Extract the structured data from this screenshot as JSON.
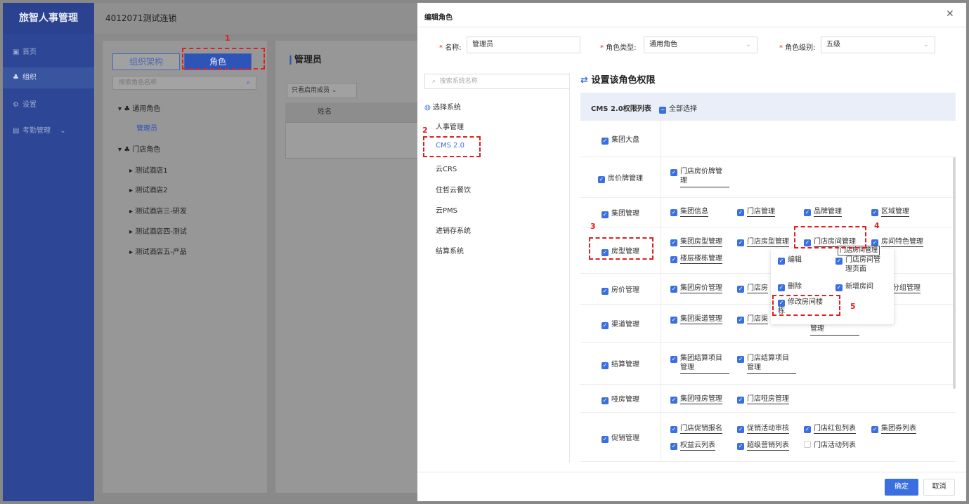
{
  "app": {
    "brand": "旅智人事管理",
    "org_name": "4012071测试连锁",
    "nav": [
      {
        "label": "首页",
        "icon": "home-icon"
      },
      {
        "label": "组织",
        "icon": "org-icon"
      },
      {
        "label": "设置",
        "icon": "gear-icon"
      },
      {
        "label": "考勤管理",
        "icon": "attendance-icon"
      }
    ]
  },
  "left_panel": {
    "tab_org": "组织架构",
    "tab_role": "角色",
    "search_placeholder": "搜索角色名称",
    "tree": {
      "general_role": "通用角色",
      "admin": "管理员",
      "store_role": "门店角色",
      "stores": [
        "测试酒店1",
        "测试酒店2",
        "测试酒店三-研发",
        "测试酒店四-测试",
        "测试酒店五-产品"
      ]
    }
  },
  "middle_panel": {
    "title": "管理员",
    "filter": "只看启用成员",
    "col_name": "姓名"
  },
  "modal": {
    "title": "编辑角色",
    "close": "✕",
    "name_label": "名称:",
    "name_value": "管理员",
    "type_label": "角色类型:",
    "type_value": "通用角色",
    "level_label": "角色级别:",
    "level_value": "五级",
    "sys_search_placeholder": "搜索系统名称",
    "sys_header": "选择系统",
    "systems": [
      "人事管理",
      "CMS 2.0",
      "云CRS",
      "住哲云餐饮",
      "云PMS",
      "进销存系统",
      "结算系统"
    ],
    "selected_system": "CMS 2.0",
    "perm_title": "设置该角色权限",
    "perm_list_label": "CMS 2.0权限列表",
    "select_all": "全部选择",
    "ok": "确定",
    "cancel": "取消"
  },
  "permissions": {
    "r1": {
      "cat": "集团大盘"
    },
    "r2": {
      "cat": "房价牌管理",
      "items": [
        "门店房价牌管",
        "理"
      ]
    },
    "r3": {
      "cat": "集团管理",
      "items": [
        "集团信息",
        "门店管理",
        "品牌管理",
        "区域管理"
      ]
    },
    "r4": {
      "cat": "房型管理",
      "items": [
        "集团房型管理",
        "门店房型管理",
        "门店房间管理",
        "房间特色管理",
        "楼层楼栋管理"
      ]
    },
    "r5": {
      "cat": "房价管理",
      "items": [
        "集团房价管理",
        "门店房",
        "分组管理"
      ]
    },
    "r6": {
      "cat": "渠道管理",
      "items": [
        "集团渠道管理",
        "门店渠",
        "管理"
      ]
    },
    "r7": {
      "cat": "结算管理",
      "items": [
        "集团结算项目",
        "管理",
        "门店结算项目",
        "管理"
      ]
    },
    "r8": {
      "cat": "哑房管理",
      "items": [
        "集团哑房管理",
        "门店哑房管理"
      ]
    },
    "r9": {
      "cat": "促销管理",
      "items": [
        "门店促销报名",
        "促销活动审核",
        "门店红包列表",
        "集团券列表",
        "权益云列表",
        "超级营销列表",
        "门店活动列表"
      ]
    }
  },
  "popup": {
    "tooltip": "门店房间管理",
    "edit": "编辑",
    "page": "门店房间管",
    "page2": "理页面",
    "delete": "删除",
    "add_room": "新增房间",
    "modify": "修改房间楼",
    "modify2": "栋"
  },
  "annotations": [
    "1",
    "2",
    "3",
    "4",
    "5"
  ]
}
